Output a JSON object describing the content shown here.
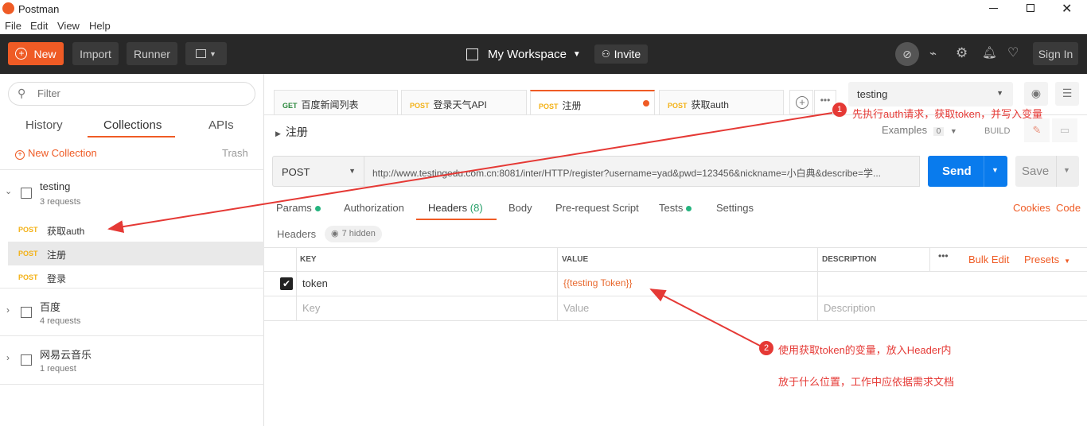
{
  "window": {
    "title": "Postman",
    "controls": [
      "minimize-icon",
      "restore-icon",
      "close-icon"
    ]
  },
  "menu": [
    "File",
    "Edit",
    "View",
    "Help"
  ],
  "toolbar": {
    "new_label": "New",
    "import_label": "Import",
    "runner_label": "Runner",
    "workspace_label": "My Workspace",
    "invite_label": "Invite",
    "signin_label": "Sign In"
  },
  "sidebar": {
    "filter_placeholder": "Filter",
    "tabs": [
      "History",
      "Collections",
      "APIs"
    ],
    "active_tab": "Collections",
    "new_collection_label": "New Collection",
    "trash_label": "Trash",
    "collections": [
      {
        "name": "testing",
        "count": "3 requests",
        "expanded": true,
        "requests": [
          {
            "method": "POST",
            "name": "获取auth"
          },
          {
            "method": "POST",
            "name": "注册"
          },
          {
            "method": "POST",
            "name": "登录"
          }
        ]
      },
      {
        "name": "百度",
        "count": "4 requests"
      },
      {
        "name": "网易云音乐",
        "count": "1 request"
      }
    ]
  },
  "request_tabs": [
    {
      "method": "GET",
      "name": "百度新闻列表"
    },
    {
      "method": "POST",
      "name": "登录天气API"
    },
    {
      "method": "POST",
      "name": "注册"
    },
    {
      "method": "POST",
      "name": "获取auth"
    }
  ],
  "environment": {
    "selected": "testing"
  },
  "request": {
    "title": "注册",
    "examples_label": "Examples",
    "examples_count": "0",
    "build_label": "BUILD",
    "method": "POST",
    "url": "http://www.testingedu.com.cn:8081/inter/HTTP/register?username=yad&pwd=123456&nickname=小白典&describe=学...",
    "send_label": "Send",
    "save_label": "Save"
  },
  "subtabs": {
    "params": "Params",
    "authorization": "Authorization",
    "headers": "Headers",
    "headers_count": "(8)",
    "body": "Body",
    "prerequest": "Pre-request Script",
    "tests": "Tests",
    "settings": "Settings",
    "cookies": "Cookies",
    "code": "Code"
  },
  "headers_section": {
    "label": "Headers",
    "hidden_label": "7 hidden",
    "columns": {
      "key": "KEY",
      "value": "VALUE",
      "description": "DESCRIPTION"
    },
    "bulk_edit": "Bulk Edit",
    "presets": "Presets",
    "rows": [
      {
        "key": "token",
        "value": "{{testing Token}}",
        "checked": true
      }
    ],
    "new_key_placeholder": "Key",
    "new_value_placeholder": "Value",
    "new_desc_placeholder": "Description"
  },
  "annotations": [
    {
      "num": "1",
      "text": "先执行auth请求，获取token，并写入变量"
    },
    {
      "num": "2",
      "text": "使用获取token的变量，放入Header内"
    },
    {
      "text": "放于什么位置，工作中应依据需求文档"
    }
  ]
}
